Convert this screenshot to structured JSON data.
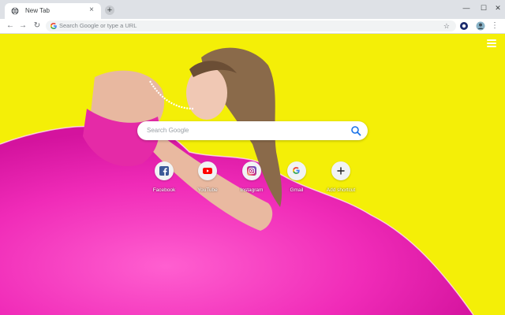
{
  "browser": {
    "tab": {
      "title": "New Tab",
      "close": "×"
    },
    "new_tab": "+",
    "window_controls": {
      "minimize": "—",
      "maximize": "☐",
      "close": "✕"
    },
    "nav": {
      "back": "←",
      "forward": "→",
      "reload": "↻"
    },
    "omnibox": {
      "placeholder": "Search Google or type a URL",
      "star": "☆"
    },
    "menu": "⋮"
  },
  "page": {
    "search_placeholder": "Search Google",
    "shortcuts": [
      {
        "label": "Facebook",
        "icon": "facebook-icon"
      },
      {
        "label": "YouTube",
        "icon": "youtube-icon"
      },
      {
        "label": "Instagram",
        "icon": "instagram-icon"
      },
      {
        "label": "Gmail",
        "icon": "google-icon"
      },
      {
        "label": "Add shortcut",
        "icon": "plus-icon"
      }
    ]
  },
  "colors": {
    "background": "#f4ef07",
    "dress": "#ef2fb5",
    "accent": "#1a73e8"
  }
}
